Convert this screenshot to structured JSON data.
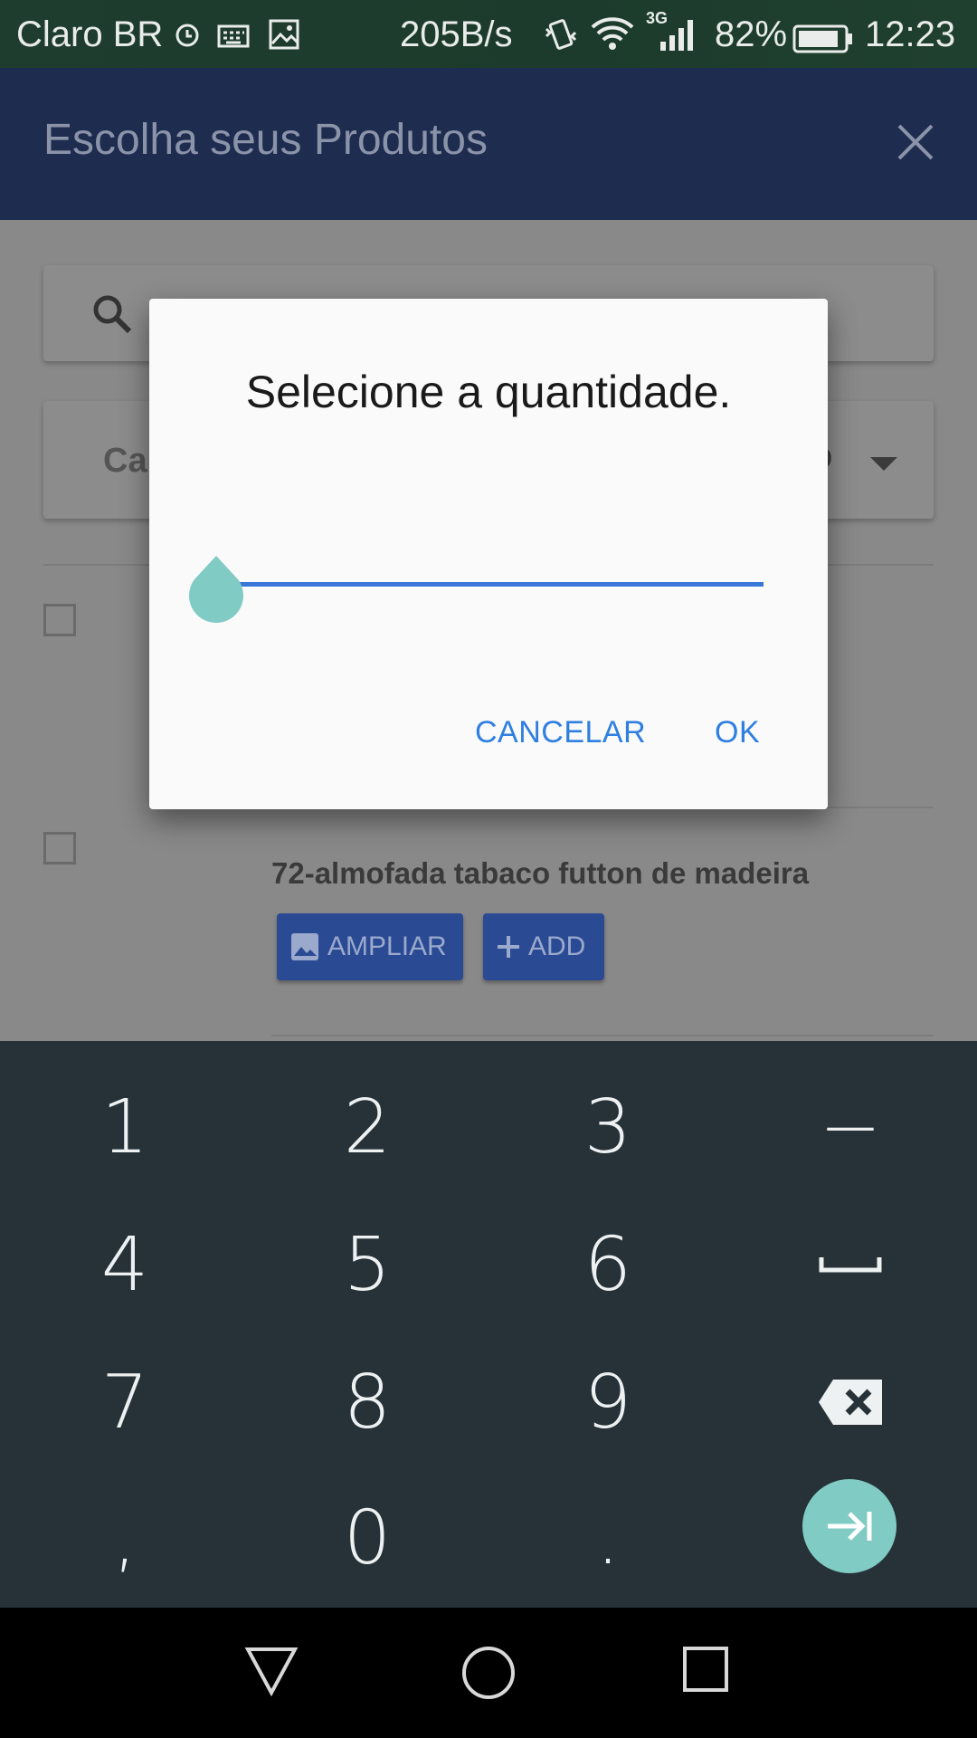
{
  "status_bar": {
    "carrier": "Claro BR",
    "net_speed": "205B/s",
    "network_type": "3G",
    "battery_percent": "82%",
    "time": "12:23",
    "icons": [
      "alarm-icon",
      "keyboard-icon",
      "image-icon",
      "vibrate-icon",
      "wifi-icon",
      "signal-icon",
      "battery-icon"
    ]
  },
  "app_bar": {
    "title": "Escolha seus Produtos",
    "close_icon": "close-icon"
  },
  "background": {
    "filter_left_partial": "Ca",
    "filter_right_partial": "do",
    "product": {
      "name": "72-almofada tabaco futton de madeira",
      "ampliar_label": "AMPLIAR",
      "add_label": "ADD"
    }
  },
  "dialog": {
    "title": "Selecione a quantidade.",
    "slider_value_fraction": 0.0,
    "cancel_label": "CANCELAR",
    "ok_label": "OK",
    "accent_color": "#3b76d9",
    "thumb_color": "#80cbc4"
  },
  "keyboard": {
    "rows": [
      [
        "1",
        "2",
        "3",
        "−"
      ],
      [
        "4",
        "5",
        "6",
        "␣"
      ],
      [
        "7",
        "8",
        "9",
        "⌫"
      ],
      [
        ",",
        "0",
        ".",
        "⇥"
      ]
    ]
  },
  "nav_bar": {
    "icons": [
      "back-icon",
      "home-icon",
      "recents-icon"
    ]
  }
}
